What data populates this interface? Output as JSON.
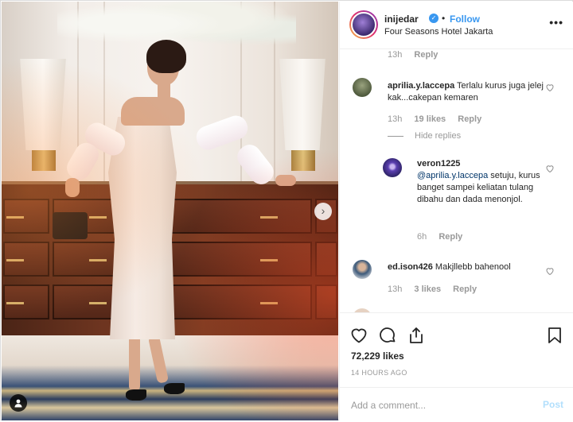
{
  "post": {
    "username": "inijedar",
    "verified_glyph": "✓",
    "dot": "•",
    "follow_label": "Follow",
    "location": "Four Seasons Hotel Jakarta",
    "more_label": "•••"
  },
  "photo": {
    "description_icon": "next-arrow",
    "next_glyph": "›"
  },
  "comments": [
    {
      "time": "13h",
      "reply_label": "Reply"
    },
    {
      "username": "aprilia.y.laccepa",
      "text": "Terlalu kurus juga jelej kak...cakepan kemaren",
      "time": "13h",
      "likes": "19 likes",
      "reply_label": "Reply",
      "hide_replies": "Hide replies"
    },
    {
      "username": "veron1225",
      "mention": "@aprilia.y.laccepa",
      "text": " setuju, kurus banget sampei keliatan tulang dibahu dan dada menonjol.",
      "time": "6h",
      "reply_label": "Reply"
    },
    {
      "username": "ed.ison426",
      "text": "Makjllebb bahenool",
      "time": "13h",
      "likes": "3 likes",
      "reply_label": "Reply"
    }
  ],
  "actions": {
    "likes": "72,229 likes",
    "time_ago": "14 HOURS AGO",
    "comment_placeholder": "Add a comment...",
    "post_label": "Post"
  },
  "colors": {
    "accent": "#3897f0",
    "muted": "#999999",
    "text": "#262626",
    "post_disabled": "#b2dffc"
  }
}
